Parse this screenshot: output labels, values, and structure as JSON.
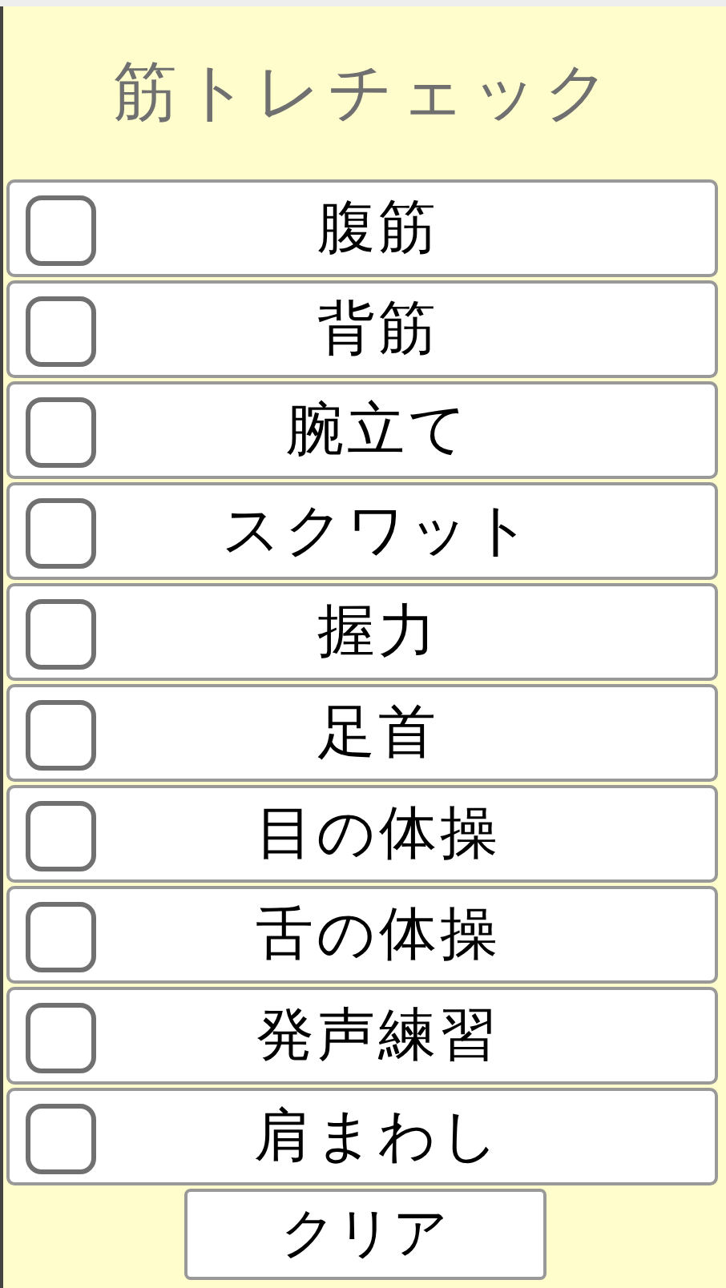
{
  "title": "筋トレチェック",
  "items": [
    {
      "label": "腹筋",
      "checked": false
    },
    {
      "label": "背筋",
      "checked": false
    },
    {
      "label": "腕立て",
      "checked": false
    },
    {
      "label": "スクワット",
      "checked": false
    },
    {
      "label": "握力",
      "checked": false
    },
    {
      "label": "足首",
      "checked": false
    },
    {
      "label": "目の体操",
      "checked": false
    },
    {
      "label": "舌の体操",
      "checked": false
    },
    {
      "label": "発声練習",
      "checked": false
    },
    {
      "label": "肩まわし",
      "checked": false
    }
  ],
  "clear_button": "クリア"
}
